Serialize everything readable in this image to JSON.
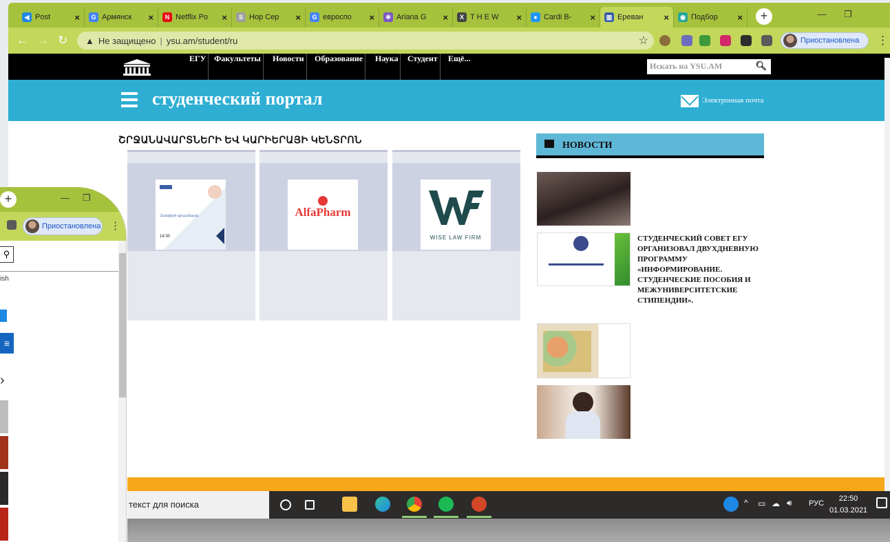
{
  "browser": {
    "tabs": [
      {
        "label": "Post",
        "fav_color": "#1e88e5",
        "fav_glyph": "◀",
        "active": false
      },
      {
        "label": "Армянск",
        "fav_color": "#4285f4",
        "fav_glyph": "G",
        "active": false
      },
      {
        "label": "Netflix Po",
        "fav_color": "#e50914",
        "fav_glyph": "N",
        "active": false
      },
      {
        "label": "Нор Сер",
        "fav_color": "#9e9e9e",
        "fav_glyph": "S",
        "active": false
      },
      {
        "label": "евроспо",
        "fav_color": "#4285f4",
        "fav_glyph": "G",
        "active": false
      },
      {
        "label": "Ariana G",
        "fav_color": "#7e57c2",
        "fav_glyph": "✻",
        "active": false
      },
      {
        "label": "T H E W",
        "fav_color": "#444444",
        "fav_glyph": "X",
        "active": false
      },
      {
        "label": "Cardi B-",
        "fav_color": "#2196f3",
        "fav_glyph": "●",
        "active": false
      },
      {
        "label": "Ереван",
        "fav_color": "#3a5ea8",
        "fav_glyph": "▥",
        "active": true
      },
      {
        "label": "Подбор",
        "fav_color": "#26a69a",
        "fav_glyph": "◉",
        "active": false
      }
    ],
    "new_tab": "+",
    "window_controls": {
      "minimize": "—",
      "restore": "❐"
    },
    "address": {
      "security": "Не защищено",
      "url": "ysu.am/student/ru"
    },
    "profile_label": "Приостановлена"
  },
  "site": {
    "nav": [
      "ЕГУ",
      "Факультеты",
      "Новости",
      "Образование",
      "Наука",
      "Студент",
      "Ещё..."
    ],
    "search_placeholder": "Искать на YSU.AM",
    "portal_title": "студенческий портал",
    "email_label": "Электронная почта",
    "section_heading": "ՇՐՋԱՆԱՎԱՐՏՆԵՐԻ ԵՎ ԿԱՐԻԵՐԱՅԻ ԿԵՆՏՐՈՆ",
    "partners": [
      {
        "name": "poster",
        "text": "Զանգերի գրասենյակ",
        "time": "14:30"
      },
      {
        "name": "AlfaPharm",
        "text": "AlfaPharm"
      },
      {
        "name": "Wise Law Firm",
        "text": "WISE LAW FIRM"
      }
    ],
    "news": {
      "header": "НОВОСТИ",
      "headline": "Студенческий совет ЕГУ организовал двухдневную программу «Информирование. Студенческие пособия и межуниверситетские стипендии»."
    }
  },
  "taskbar": {
    "search_placeholder": "текст для поиска",
    "lang": "РУС",
    "time": "22:50",
    "date": "01.03.2021",
    "apps": [
      {
        "name": "cortana",
        "color": "#2d2a2a"
      },
      {
        "name": "task-view",
        "color": "#2d2a2a"
      },
      {
        "name": "explorer",
        "color": "#f6c24a"
      },
      {
        "name": "edge",
        "color": "#1e88e5"
      },
      {
        "name": "chrome",
        "color": "#e8b43a"
      },
      {
        "name": "spotify",
        "color": "#1db954"
      },
      {
        "name": "powerpoint",
        "color": "#d24726"
      }
    ]
  },
  "secondary_window": {
    "profile_label": "Приостановлена",
    "language_fragment": "ish",
    "new_tab": "+",
    "minimize": "—",
    "restore": "❐"
  },
  "colors": {
    "accent_green": "#a6c23c",
    "portal_blue": "#2eaed3",
    "footer_orange": "#f7a81a"
  }
}
